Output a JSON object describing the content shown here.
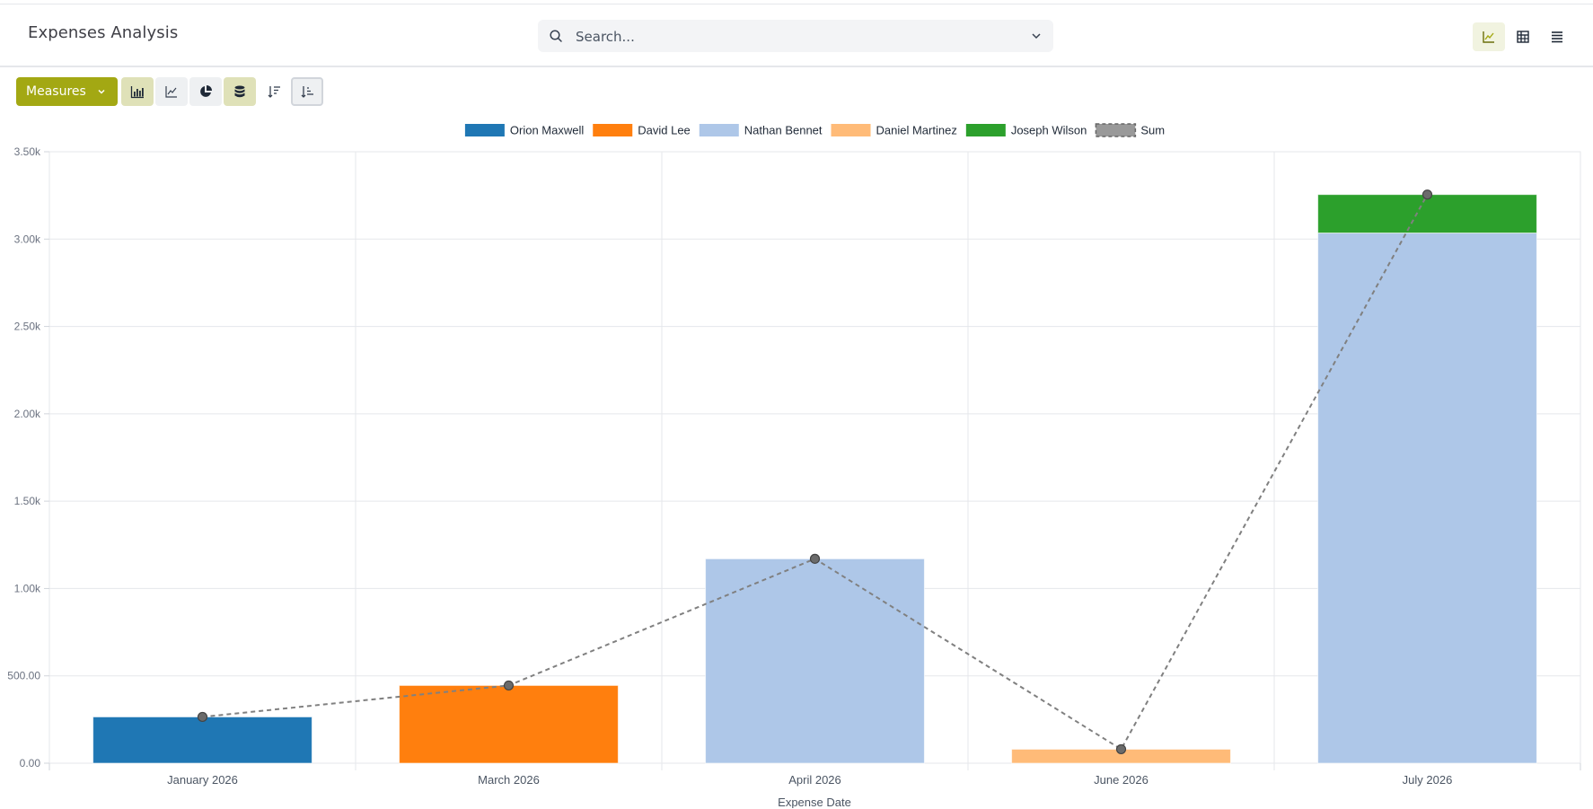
{
  "header": {
    "title": "Expenses Analysis",
    "search": {
      "placeholder": "Search...",
      "search_icon": "search-icon",
      "dropdown_icon": "chevron-down-icon"
    },
    "view_switch": [
      {
        "name": "graph-view",
        "icon": "line-chart-icon",
        "active": true
      },
      {
        "name": "pivot-view",
        "icon": "pivot-table-icon",
        "active": false
      },
      {
        "name": "list-view",
        "icon": "list-icon",
        "active": false
      }
    ]
  },
  "toolbar": {
    "measures_label": "Measures",
    "buttons": [
      {
        "name": "bar-chart-button",
        "icon": "bar-chart-icon",
        "active": true
      },
      {
        "name": "line-chart-button",
        "icon": "line-chart-icon",
        "active": false
      },
      {
        "name": "pie-chart-button",
        "icon": "pie-chart-icon",
        "active": false
      },
      {
        "name": "stacked-button",
        "icon": "database-stack-icon",
        "active": true
      },
      {
        "name": "descending-button",
        "icon": "sort-descending-icon",
        "active": false
      },
      {
        "name": "ascending-button",
        "icon": "sort-ascending-icon",
        "active": false
      }
    ]
  },
  "colors": {
    "accent": "#a3a813",
    "grid": "#e5e7eb"
  },
  "chart_data": {
    "type": "bar",
    "stacked": true,
    "xlabel": "Expense Date",
    "ylabel": "",
    "ylim": [
      0,
      3500
    ],
    "yticks": [
      0,
      500,
      1000,
      1500,
      2000,
      2500,
      3000,
      3500
    ],
    "ytick_labels": [
      "0.00",
      "500.00",
      "1.00k",
      "1.50k",
      "2.00k",
      "2.50k",
      "3.00k",
      "3.50k"
    ],
    "legend_position": "top-center",
    "grid": true,
    "categories": [
      "January 2026",
      "March 2026",
      "April 2026",
      "June 2026",
      "July 2026"
    ],
    "series": [
      {
        "name": "Orion Maxwell",
        "color": "#1f77b4",
        "values": [
          265,
          0,
          0,
          0,
          0
        ]
      },
      {
        "name": "David Lee",
        "color": "#ff7f0e",
        "values": [
          0,
          445,
          0,
          0,
          0
        ]
      },
      {
        "name": "Nathan Bennet",
        "color": "#aec7e8",
        "values": [
          0,
          0,
          1170,
          0,
          3035
        ]
      },
      {
        "name": "Daniel Martinez",
        "color": "#ffbb78",
        "values": [
          0,
          0,
          0,
          80,
          0
        ]
      },
      {
        "name": "Joseph Wilson",
        "color": "#2ca02c",
        "values": [
          0,
          0,
          0,
          0,
          220
        ]
      }
    ],
    "sum_series": {
      "name": "Sum",
      "color": "#808080",
      "line_style": "dashed",
      "values": [
        265,
        445,
        1170,
        80,
        3255
      ]
    }
  }
}
